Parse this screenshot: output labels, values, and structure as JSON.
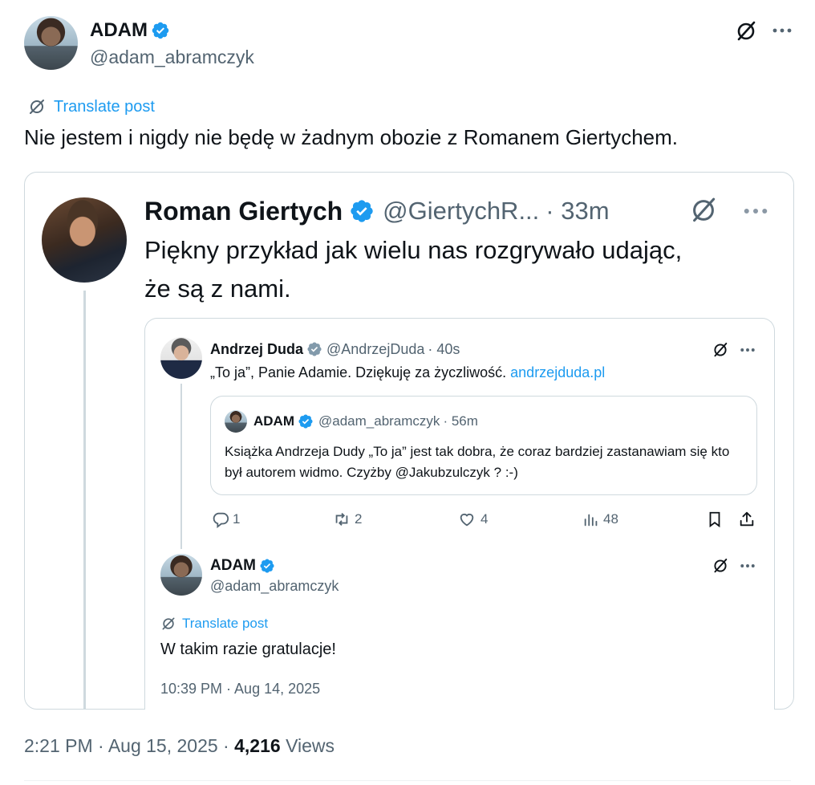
{
  "main_post": {
    "author_name": "ADAM",
    "author_handle": "@adam_abramczyk",
    "translate_label": "Translate post",
    "text": "Nie jestem i nigdy nie będę w żadnym obozie z Romanem Giertychem.",
    "timestamp": "2:21 PM · Aug 15, 2025 ·",
    "views_count": "4,216",
    "views_label": "Views"
  },
  "quoted_post": {
    "author_name": "Roman Giertych",
    "author_handle": "@GiertychR...",
    "time": "· 33m",
    "text": "Piękny przykład jak wielu nas rozgrywało udając, że są z nami."
  },
  "duda_post": {
    "author_name": "Andrzej Duda",
    "author_handle": "@AndrzejDuda",
    "time": "· 40s",
    "text": "„To ja”, Panie Adamie. Dziękuję za życzliwość.",
    "link_text": "andrzejduda.pl",
    "stats": {
      "replies": "1",
      "reposts": "2",
      "likes": "4",
      "views": "48"
    }
  },
  "nested_quote": {
    "author_name": "ADAM",
    "author_handle": "@adam_abramczyk",
    "time": "· 56m",
    "text": "Książka Andrzeja Dudy „To ja” jest tak dobra, że coraz bardziej zastanawiam się kto był autorem widmo. Czyżby @Jakubzulczyk ? :-)"
  },
  "reply_post": {
    "author_name": "ADAM",
    "author_handle": "@adam_abramczyk",
    "translate_label": "Translate post",
    "text": "W takim razie gratulacje!",
    "timestamp": "10:39 PM · Aug 14, 2025"
  },
  "colors": {
    "accent": "#1d9bf0",
    "text": "#0f1419",
    "muted": "#536471",
    "border": "#cfd9de"
  },
  "icons": [
    "grok-icon",
    "more-icon",
    "verified-badge-icon",
    "translate-icon",
    "reply-icon",
    "repost-icon",
    "like-icon",
    "views-icon",
    "bookmark-icon",
    "share-icon"
  ]
}
